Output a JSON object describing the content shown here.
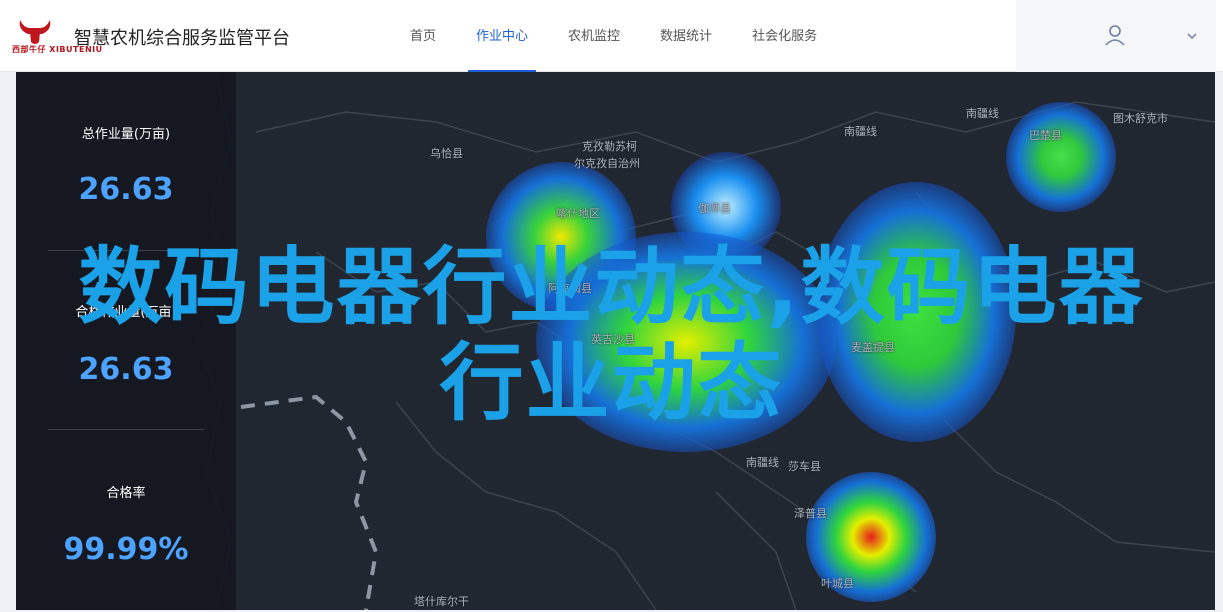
{
  "header": {
    "logo_text": "西部牛仔 XIBUTENIU",
    "title": "智慧农机综合服务监管平台",
    "nav": [
      {
        "label": "首页",
        "active": false
      },
      {
        "label": "作业中心",
        "active": true
      },
      {
        "label": "农机监控",
        "active": false
      },
      {
        "label": "数据统计",
        "active": false
      },
      {
        "label": "社会化服务",
        "active": false
      }
    ],
    "user_icon": "user-icon",
    "dropdown_icon": "chevron-down-icon"
  },
  "stats": {
    "total_work_label": "总作业量(万亩)",
    "total_work_value": "26.63",
    "qualified_work_label": "合格作业量(万亩)",
    "qualified_work_value": "26.63",
    "pass_rate_label": "合格率",
    "pass_rate_value": "99.99%"
  },
  "map": {
    "labels": [
      {
        "id": "wuqia",
        "text": "乌恰县"
      },
      {
        "id": "kezhou",
        "text": "克孜勒苏柯"
      },
      {
        "id": "kezhou2",
        "text": "尔克孜自治州"
      },
      {
        "id": "kashi",
        "text": "喀什地区"
      },
      {
        "id": "jiashi",
        "text": "伽师县"
      },
      {
        "id": "nanjiang",
        "text": "南疆线"
      },
      {
        "id": "nanjiang2",
        "text": "南疆线"
      },
      {
        "id": "tumushuke",
        "text": "图木舒克市"
      },
      {
        "id": "bachu",
        "text": "巴楚县"
      },
      {
        "id": "akekezi",
        "text": "阿克陶县"
      },
      {
        "id": "yingjisha",
        "text": "英吉沙县"
      },
      {
        "id": "maigaiti",
        "text": "麦盖提县"
      },
      {
        "id": "nanjiang3",
        "text": "南疆线"
      },
      {
        "id": "shache",
        "text": "莎车县"
      },
      {
        "id": "zepu",
        "text": "泽普县"
      },
      {
        "id": "yecheng",
        "text": "叶城县"
      },
      {
        "id": "tashikuergan",
        "text": "塔什库尔干"
      }
    ]
  },
  "overlay": {
    "line1": "数码电器行业动态,数码电器",
    "line2": "行业动态"
  },
  "colors": {
    "accent": "#1f5fd8",
    "stat_value": "#4da3ff",
    "overlay_text": "#1aa1e8",
    "map_bg": "#212730"
  }
}
